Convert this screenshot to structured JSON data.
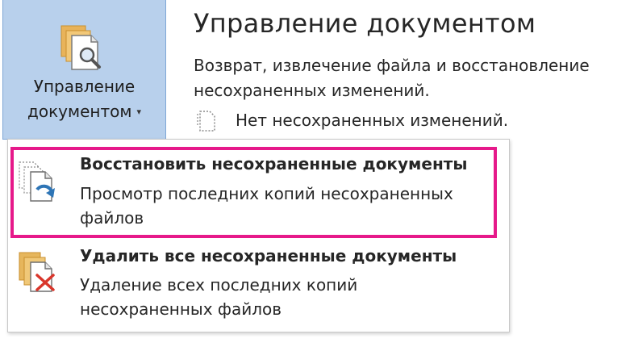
{
  "ribbon": {
    "manage_button": {
      "label_line1": "Управление",
      "label_line2": "документом",
      "icon": "document-search-icon",
      "bg_color": "#b8d0ec"
    },
    "chevron": "▾"
  },
  "panel": {
    "title": "Управление документом",
    "description": "Возврат, извлечение файла и восстановление несохраненных изменений.",
    "status_text": "Нет несохраненных изменений.",
    "status_icon": "blank-document-icon"
  },
  "menu": {
    "items": [
      {
        "title": "Восстановить несохраненные документы",
        "description": "Просмотр последних копий несохраненных файлов",
        "icon": "recover-documents-icon"
      },
      {
        "title": "Удалить все несохраненные документы",
        "description": "Удаление всех последних копий несохраненных файлов",
        "icon": "delete-documents-icon"
      }
    ]
  },
  "colors": {
    "highlight": "#e6198a",
    "accent_blue": "#2e75b6",
    "delete_red": "#d9362b",
    "doc_yellow": "#e6b65c"
  }
}
